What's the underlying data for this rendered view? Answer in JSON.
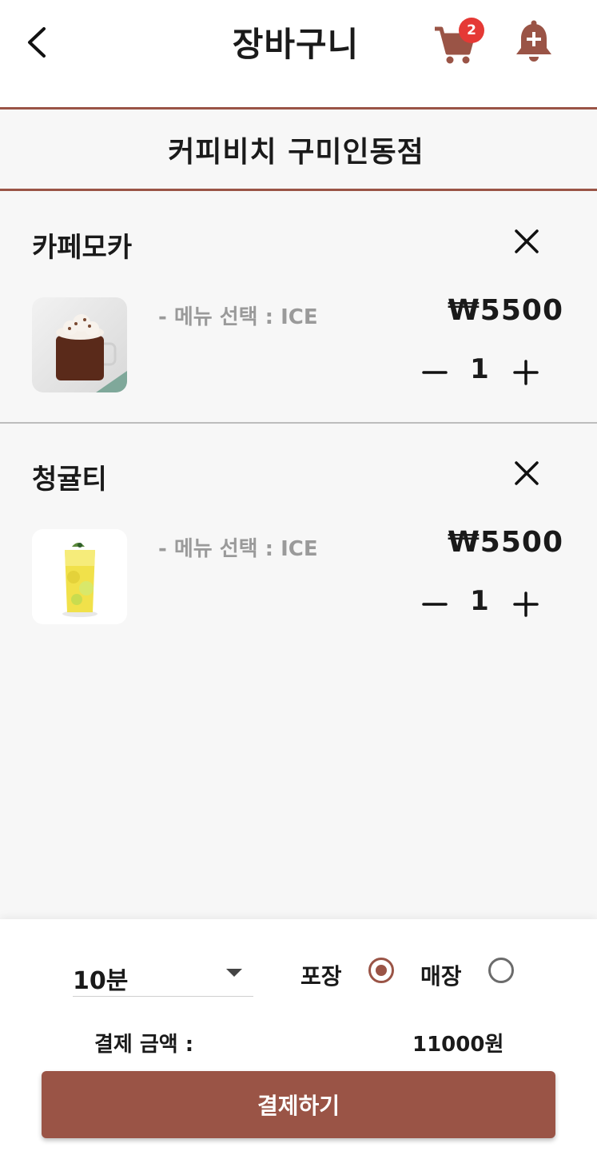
{
  "header": {
    "title": "장바구니",
    "cart_count": "2",
    "back_icon": "chevron-left-icon",
    "cart_icon": "shopping-cart-icon",
    "bell_icon": "bell-plus-icon"
  },
  "store": {
    "name": "커피비치 구미인동점"
  },
  "cart": {
    "items": [
      {
        "name": "카페모카",
        "option": "- 메뉴 선택 : ICE",
        "price": "₩5500",
        "quantity": "1"
      },
      {
        "name": "청귤티",
        "option": "- 메뉴 선택 : ICE",
        "price": "₩5500",
        "quantity": "1"
      }
    ]
  },
  "order": {
    "time_selected": "10분",
    "takeout_label": "포장",
    "dinein_label": "매장",
    "takeout_checked": true,
    "dinein_checked": false,
    "total_label": "결제 금액 :",
    "total_value": "11000원",
    "pay_label": "결제하기"
  },
  "colors": {
    "accent": "#9a5446",
    "badge": "#e53935",
    "muted_text": "#9a9a9a"
  }
}
